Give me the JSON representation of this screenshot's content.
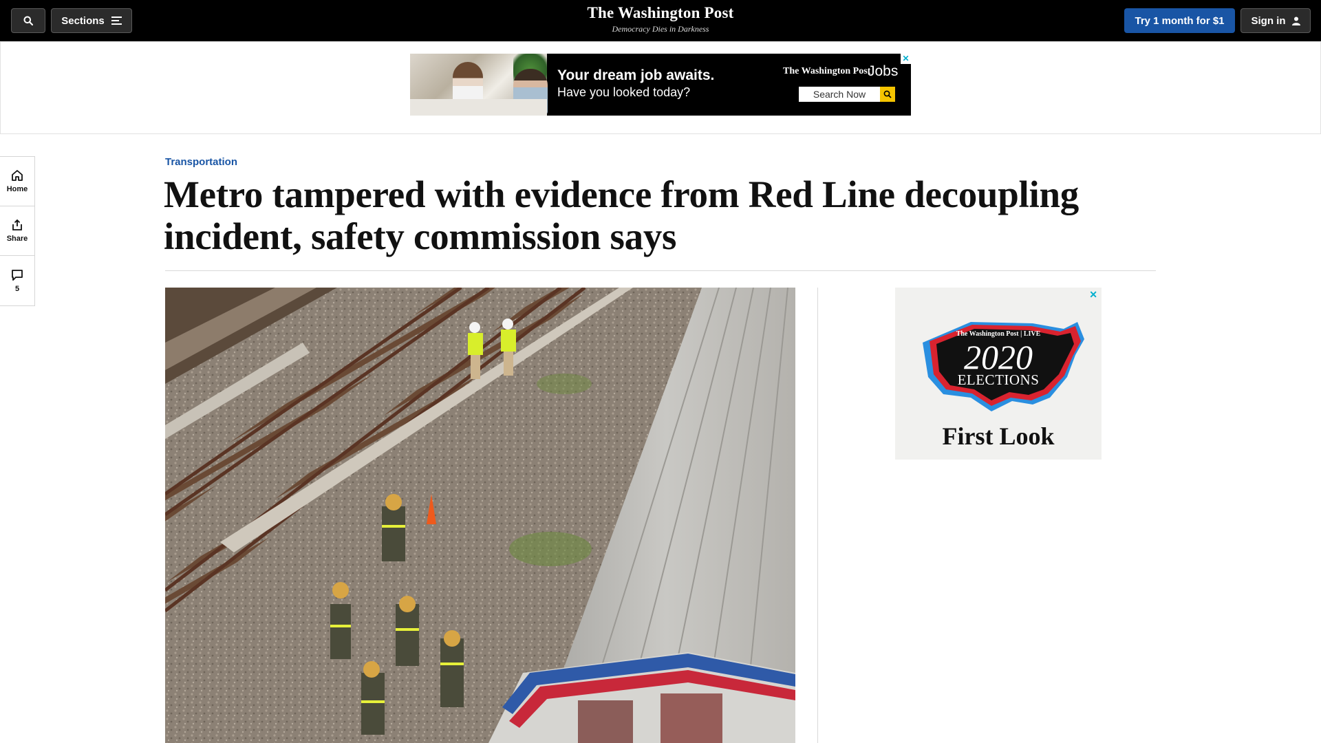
{
  "header": {
    "search_icon": "search-icon",
    "sections_label": "Sections",
    "masthead_name": "The Washington Post",
    "masthead_tagline": "Democracy Dies in Darkness",
    "subscribe_label": "Try 1 month for $1",
    "signin_label": "Sign in"
  },
  "top_ad": {
    "headline": "Your dream job awaits.",
    "subline": "Have you looked today?",
    "brand": "The Washington Post",
    "brand_suffix": "Jobs",
    "search_label": "Search Now",
    "close_label": "✕"
  },
  "rail": {
    "items": [
      {
        "label": "Home",
        "icon": "home-icon"
      },
      {
        "label": "Share",
        "icon": "share-icon"
      },
      {
        "label": "5",
        "icon": "comment-icon"
      }
    ]
  },
  "article": {
    "kicker": "Transportation",
    "headline": "Metro tampered with evidence from Red Line decoupling incident, safety commission says"
  },
  "side_ad": {
    "close_label": "✕",
    "brand": "The Washington Post | LIVE",
    "year": "2020",
    "word": "ELECTIONS",
    "title": "First Look"
  },
  "colors": {
    "topbar_bg": "#000000",
    "subscribe_blue": "#1955a5",
    "kicker_blue": "#1955a5"
  }
}
